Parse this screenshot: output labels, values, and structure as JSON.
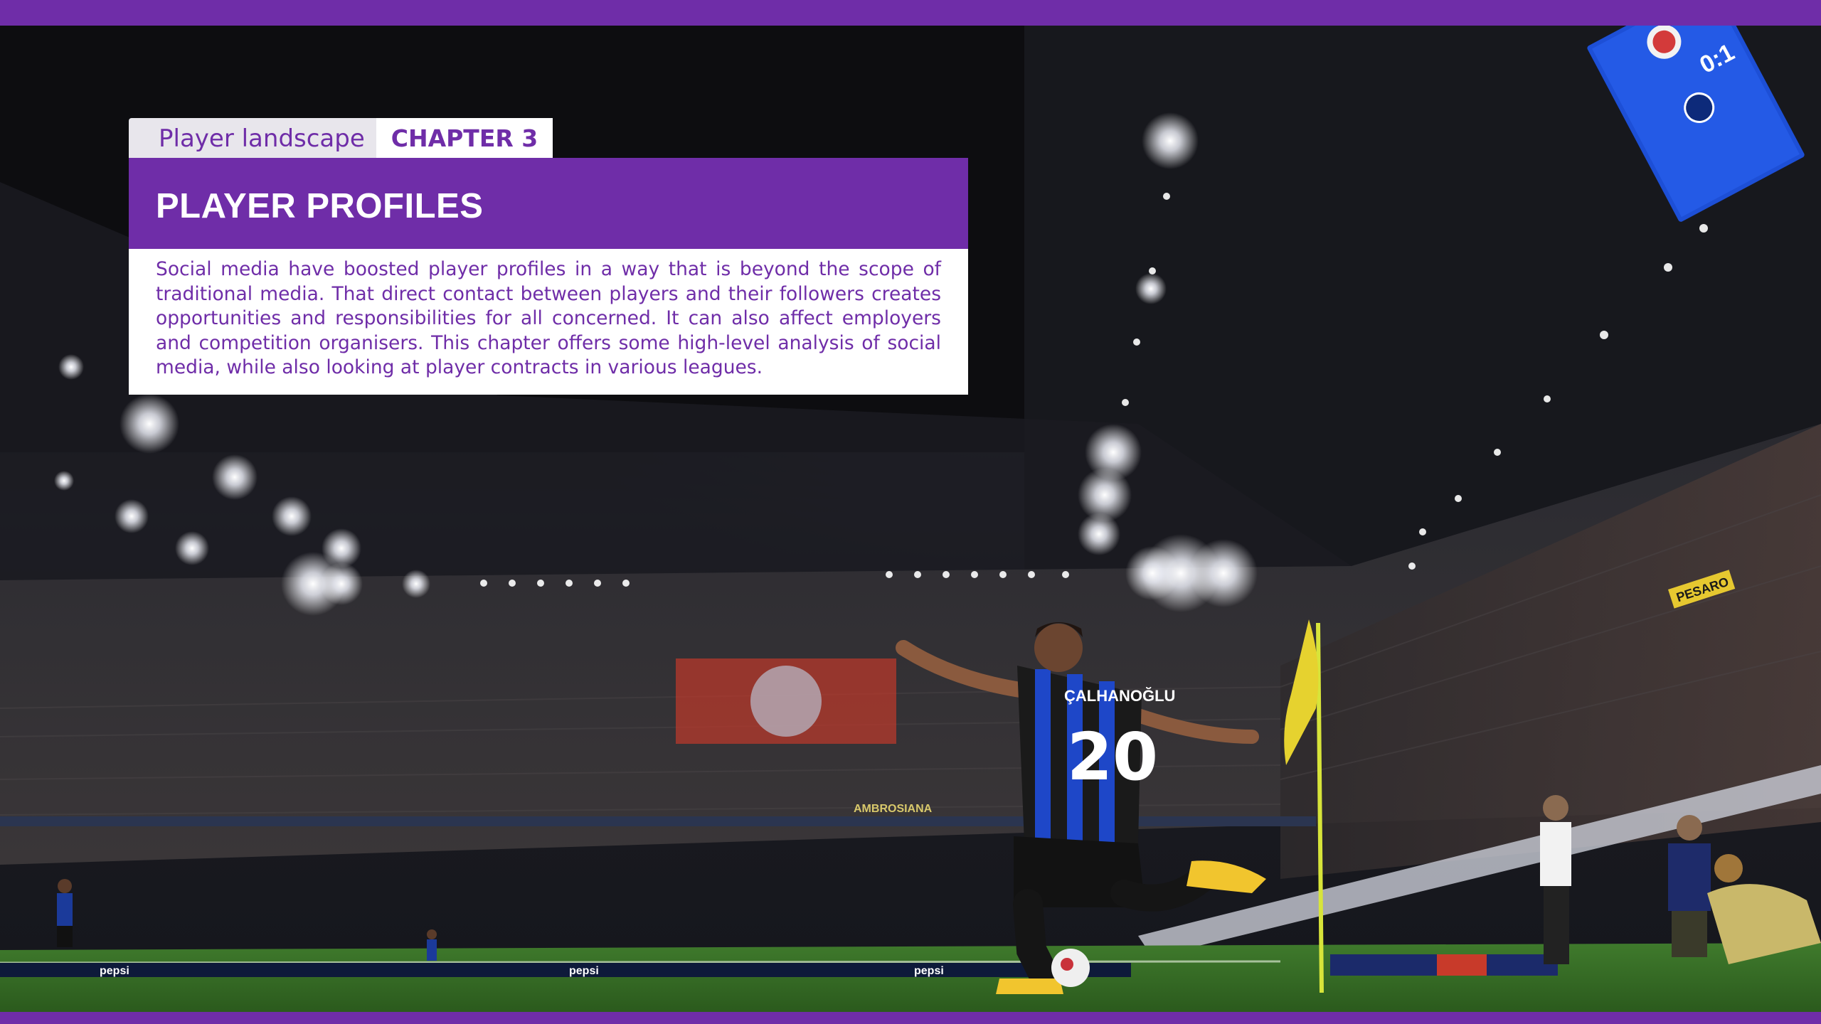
{
  "header": {
    "tab_landscape": "Player landscape",
    "tab_chapter": "CHAPTER 3"
  },
  "section": {
    "title": "PLAYER PROFILES",
    "body": "Social media have boosted player profiles in a way that is beyond the scope of traditional media. That direct contact between players and their followers creates opportunities and responsibilities for all concerned. It can also affect employers and competition organisers. This chapter offers some high-level analysis of social media, while also looking at player contracts in various leagues."
  },
  "photo": {
    "player_name": "ÇALHANOĞLU",
    "player_number": "20",
    "scoreboard_score": "0:1",
    "pitch_board_sponsor": "pepsi",
    "stand_banner": "PESARO",
    "tier_banner": "AMBROSIANA"
  },
  "colors": {
    "accent": "#6f2da8",
    "tab_inactive_bg": "#e8e6ec",
    "white": "#ffffff"
  }
}
